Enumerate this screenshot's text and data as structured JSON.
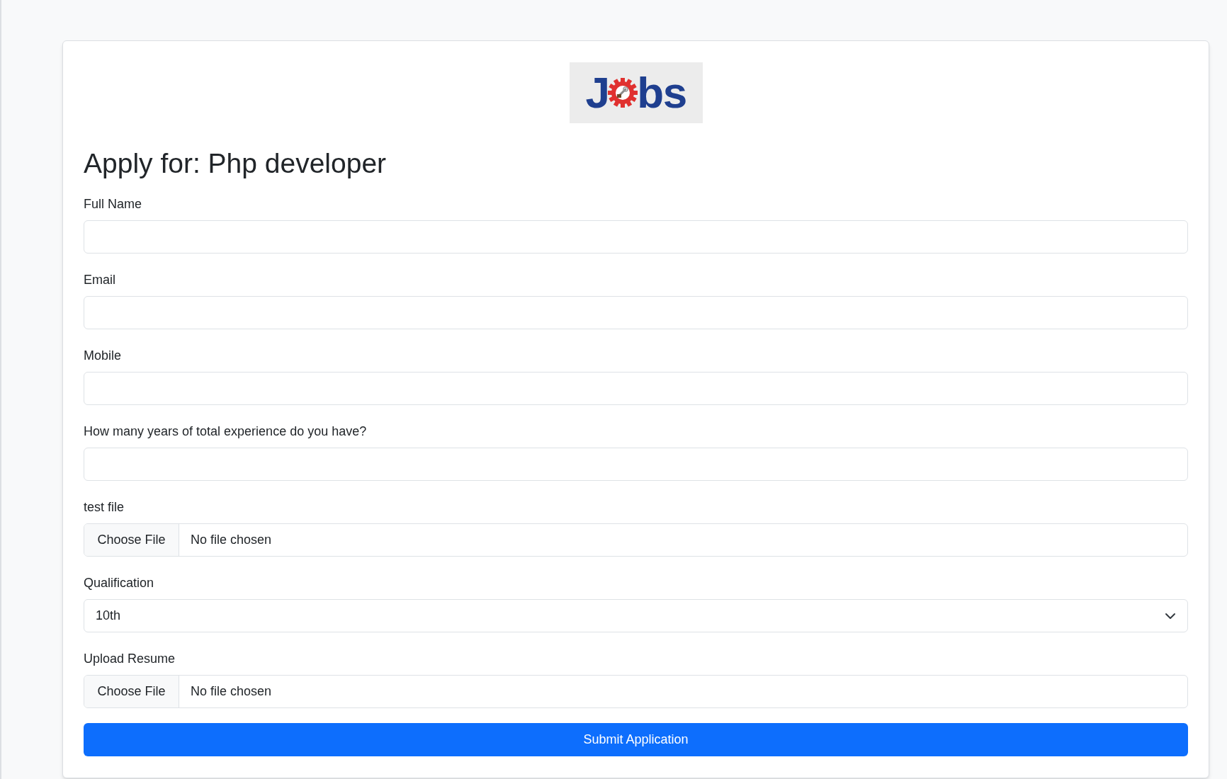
{
  "logo": {
    "letter": "J",
    "rest": "bs"
  },
  "heading": "Apply for: Php developer",
  "fields": [
    {
      "kind": "text",
      "label": "Full Name"
    },
    {
      "kind": "text",
      "label": "Email"
    },
    {
      "kind": "text",
      "label": "Mobile"
    },
    {
      "kind": "text",
      "label": "How many years of total experience do you have?"
    },
    {
      "kind": "file",
      "label": "test file",
      "button": "Choose File",
      "status": "No file chosen"
    },
    {
      "kind": "select",
      "label": "Qualification",
      "value": "10th"
    },
    {
      "kind": "file",
      "label": "Upload Resume",
      "button": "Choose File",
      "status": "No file chosen"
    }
  ],
  "submit": "Submit Application"
}
